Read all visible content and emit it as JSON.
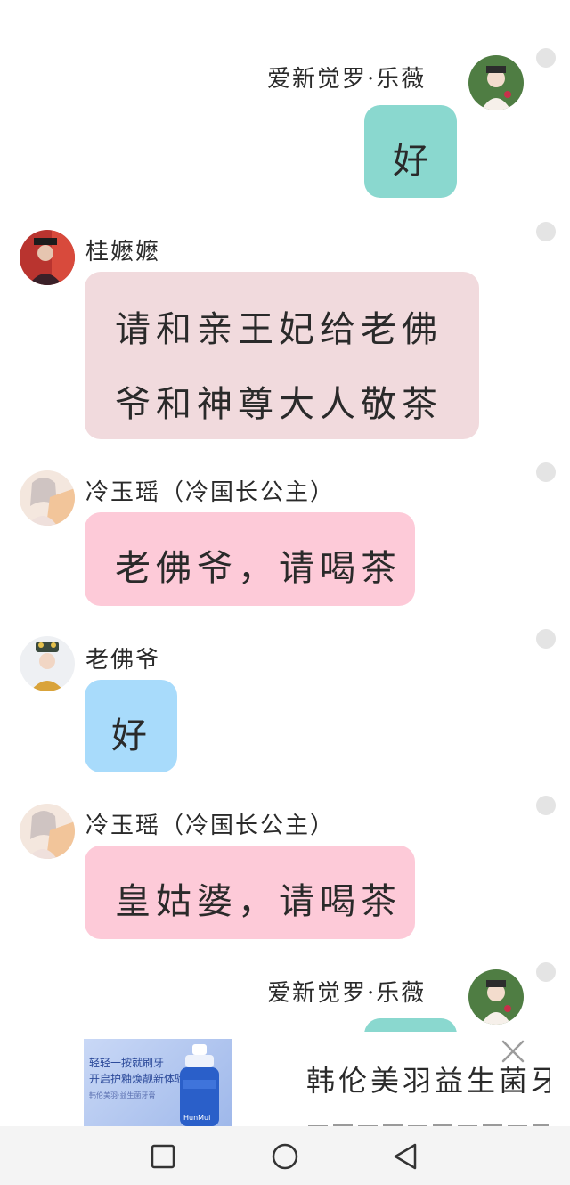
{
  "messages": [
    {
      "sender": "爱新觉罗·乐薇",
      "text": "好"
    },
    {
      "sender": "桂嬷嬷",
      "text_line1": "请和亲王妃给老佛",
      "text_line2": "爷和神尊大人敬茶"
    },
    {
      "sender": "冷玉瑶（冷国长公主）",
      "text": "老佛爷，请喝茶"
    },
    {
      "sender": "老佛爷",
      "text": "好"
    },
    {
      "sender": "冷玉瑶（冷国长公主）",
      "text": "皇姑婆，请喝茶"
    },
    {
      "sender": "爱新觉罗·乐薇",
      "text": ""
    }
  ],
  "ad": {
    "image_line1": "轻轻一按就刷牙",
    "image_line2": "开启护釉焕靓新体验",
    "image_line3": "韩伦美羽·益生菌牙膏",
    "brand_mark": "HunMui",
    "title": "韩伦美羽益生菌牙膏",
    "close_icon": "close-icon"
  },
  "colors": {
    "green_bubble": "#8ad8cf",
    "mauve_bubble": "#f1dadd",
    "pink_bubble": "#fdcad8",
    "blue_bubble": "#a8dbfb",
    "dot": "#e4e4e4"
  },
  "navbar": {
    "icons": [
      "recent-apps-icon",
      "home-icon",
      "back-icon"
    ]
  }
}
